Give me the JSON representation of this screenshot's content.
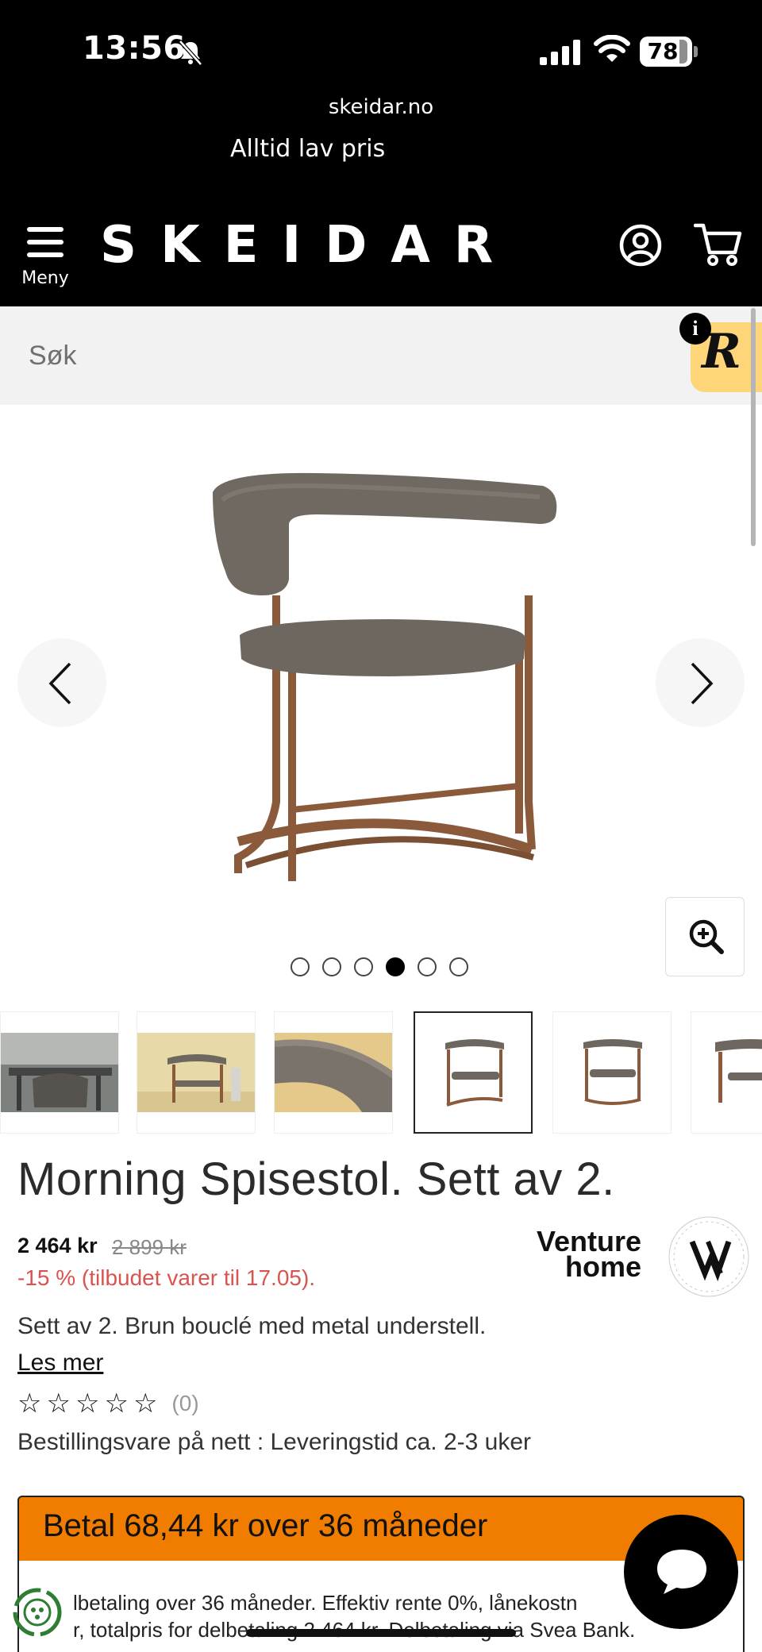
{
  "status_bar": {
    "time": "13:56",
    "battery": "78"
  },
  "browser": {
    "url": "skeidar.no"
  },
  "header": {
    "tagline": "Alltid lav pris",
    "menu_label": "Meny",
    "logo": "SKEIDAR"
  },
  "search": {
    "placeholder": "Søk"
  },
  "widget": {
    "info": "i",
    "letter": "R"
  },
  "gallery": {
    "slide_count": 6,
    "active_index": 3,
    "thumbnail_count": 6,
    "active_thumbnail": 3
  },
  "product": {
    "title": "Morning Spisestol. Sett av 2.",
    "price": "2 464 kr",
    "old_price": "2 899 kr",
    "discount": "-15 % (tilbudet varer til 17.05).",
    "brand_line1": "Venture",
    "brand_line2": "home",
    "description": "Sett av 2. Brun bouclé med metal understell.",
    "read_more": "Les mer",
    "rating_stars": 0,
    "review_count": "(0)",
    "delivery": "Bestillingsvare på nett : Leveringstid ca. 2-3 uker"
  },
  "financing": {
    "button_label": "Betal 68,44 kr over 36 måneder",
    "line1": "lbetaling over 36 måneder. Effektiv rente 0%, lånekostn",
    "line2": "r, totalpris for delbetaling 2 464 kr. Delbetaling via Svea Bank."
  },
  "colors": {
    "header_bg": "#000000",
    "accent_orange": "#f07c00",
    "discount_red": "#d9534f",
    "chair_fabric": "#6e6760",
    "chair_frame": "#8a5a3b"
  }
}
